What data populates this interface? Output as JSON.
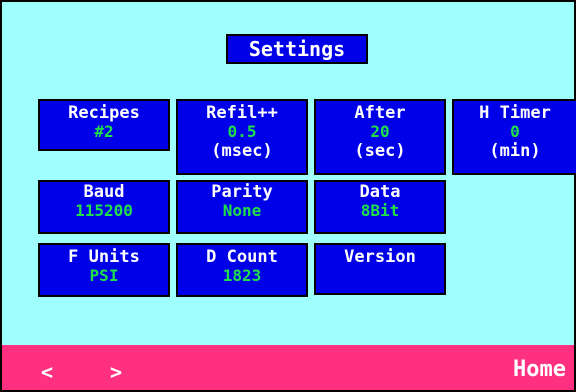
{
  "title": "Settings",
  "tiles": {
    "recipes": {
      "label": "Recipes",
      "value": "#2"
    },
    "refill": {
      "label": "Refil++",
      "value": "0.5",
      "unit": "(msec)"
    },
    "after": {
      "label": "After",
      "value": "20",
      "unit": "(sec)"
    },
    "htimer": {
      "label": "H Timer",
      "value": "0",
      "unit": "(min)"
    },
    "baud": {
      "label": "Baud",
      "value": "115200"
    },
    "parity": {
      "label": "Parity",
      "value": "None"
    },
    "data": {
      "label": "Data",
      "value": "8Bit"
    },
    "funits": {
      "label": "F Units",
      "value": "PSI"
    },
    "dcount": {
      "label": "D Count",
      "value": "1823"
    },
    "version": {
      "label": "Version"
    }
  },
  "footer": {
    "prev": "<",
    "next": ">",
    "home": "Home"
  },
  "colors": {
    "background": "#9ffffc",
    "tile": "#0000e8",
    "value_text": "#1ee04a",
    "footer": "#ff3080"
  }
}
